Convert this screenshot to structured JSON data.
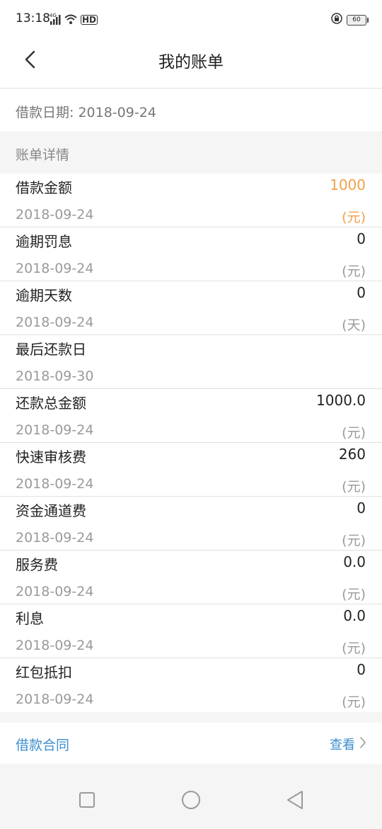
{
  "status_bar": {
    "time": "13:18",
    "network": "4G",
    "hd": "HD",
    "battery": "60"
  },
  "header": {
    "title": "我的账单"
  },
  "loan_date": {
    "label": "借款日期:",
    "value": "2018-09-24"
  },
  "section": {
    "title": "账单详情"
  },
  "bill_items": [
    {
      "label": "借款金额",
      "value": "1000",
      "date": "2018-09-24",
      "unit": "(元)"
    },
    {
      "label": "逾期罚息",
      "value": "0",
      "date": "2018-09-24",
      "unit": "(元)"
    },
    {
      "label": "逾期天数",
      "value": "0",
      "date": "2018-09-24",
      "unit": "(天)"
    },
    {
      "label": "最后还款日",
      "value": "",
      "date": "2018-09-30",
      "unit": ""
    },
    {
      "label": "还款总金额",
      "value": "1000.0",
      "date": "2018-09-24",
      "unit": "(元)"
    },
    {
      "label": "快速审核费",
      "value": "260",
      "date": "2018-09-24",
      "unit": "(元)"
    },
    {
      "label": "资金通道费",
      "value": "0",
      "date": "2018-09-24",
      "unit": "(元)"
    },
    {
      "label": "服务费",
      "value": "0.0",
      "date": "2018-09-24",
      "unit": "(元)"
    },
    {
      "label": "利息",
      "value": "0.0",
      "date": "2018-09-24",
      "unit": "(元)"
    },
    {
      "label": "红包抵扣",
      "value": "0",
      "date": "2018-09-24",
      "unit": "(元)"
    }
  ],
  "contract": {
    "label": "借款合同",
    "action": "查看"
  },
  "colors": {
    "highlight": "#f0a14a",
    "link": "#3d8fd0"
  },
  "icons": {
    "back": "chevron-left-icon",
    "contract_arrow": "chevron-right-icon",
    "nav_recent": "square-icon",
    "nav_home": "circle-icon",
    "nav_back": "triangle-back-icon"
  }
}
